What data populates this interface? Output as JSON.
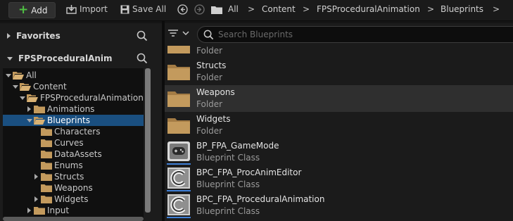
{
  "toolbar": {
    "add_label": "Add",
    "import_label": "Import",
    "save_all_label": "Save All",
    "breadcrumbs": [
      "All",
      "Content",
      "FPSProceduralAnimation",
      "Blueprints"
    ],
    "separator": ">"
  },
  "left": {
    "favorites_label": "Favorites",
    "project_label": "FPSProceduralAnim",
    "tree": [
      {
        "label": "All",
        "depth": 0,
        "expander": "down",
        "open": true
      },
      {
        "label": "Content",
        "depth": 1,
        "expander": "down",
        "open": true
      },
      {
        "label": "FPSProceduralAnimation",
        "depth": 2,
        "expander": "down",
        "open": true
      },
      {
        "label": "Animations",
        "depth": 3,
        "expander": "right",
        "open": false
      },
      {
        "label": "Blueprints",
        "depth": 3,
        "expander": "down",
        "open": true,
        "selected": true
      },
      {
        "label": "Characters",
        "depth": 4,
        "expander": "none",
        "open": false
      },
      {
        "label": "Curves",
        "depth": 4,
        "expander": "none",
        "open": false
      },
      {
        "label": "DataAssets",
        "depth": 4,
        "expander": "none",
        "open": false
      },
      {
        "label": "Enums",
        "depth": 4,
        "expander": "none",
        "open": false
      },
      {
        "label": "Structs",
        "depth": 4,
        "expander": "right",
        "open": false
      },
      {
        "label": "Weapons",
        "depth": 4,
        "expander": "none",
        "open": false
      },
      {
        "label": "Widgets",
        "depth": 4,
        "expander": "right",
        "open": false
      },
      {
        "label": "Input",
        "depth": 3,
        "expander": "right",
        "open": false
      }
    ]
  },
  "right": {
    "search_placeholder": "Search Blueprints",
    "items": [
      {
        "name": "",
        "type": "Folder",
        "kind": "folder",
        "highlighted": false
      },
      {
        "name": "Structs",
        "type": "Folder",
        "kind": "folder",
        "highlighted": false
      },
      {
        "name": "Weapons",
        "type": "Folder",
        "kind": "folder",
        "highlighted": true
      },
      {
        "name": "Widgets",
        "type": "Folder",
        "kind": "folder",
        "highlighted": false
      },
      {
        "name": "BP_FPA_GameMode",
        "type": "Blueprint Class",
        "kind": "gamemode",
        "highlighted": false
      },
      {
        "name": "BPC_FPA_ProcAnimEditor",
        "type": "Blueprint Class",
        "kind": "component",
        "highlighted": false
      },
      {
        "name": "BPC_FPA_ProceduralAnimation",
        "type": "Blueprint Class",
        "kind": "component",
        "highlighted": false
      }
    ]
  },
  "colors": {
    "selection": "#1a4f80",
    "folder": "#c39a5d",
    "add_plus": "#4fc043",
    "class_underline": "#3f7fd6"
  }
}
